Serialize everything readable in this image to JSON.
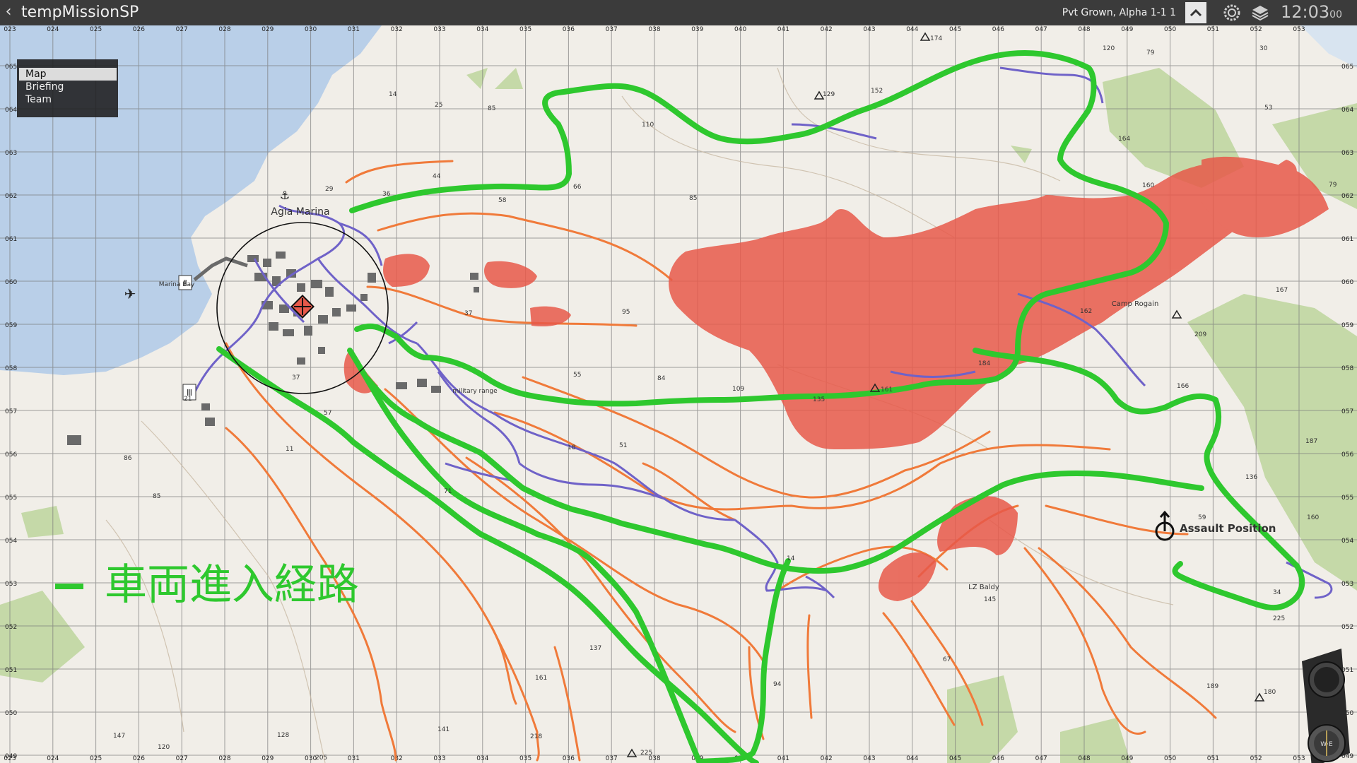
{
  "window": {
    "title": "tempMissionSP",
    "player": "Pvt Grown, Alpha 1-1 1",
    "time": "12:03",
    "time_seconds": "00"
  },
  "icons": {
    "back": "chevron-left-icon",
    "toggle": "chevron-up-icon",
    "settings": "gear-icon",
    "layers": "layers-icon",
    "compass": "compass-icon"
  },
  "menu": {
    "items": [
      {
        "label": "Map",
        "active": true
      },
      {
        "label": "Briefing",
        "active": false
      },
      {
        "label": "Team",
        "active": false
      }
    ]
  },
  "grid": {
    "x_labels": [
      "023",
      "024",
      "025",
      "026",
      "027",
      "028",
      "029",
      "030",
      "031",
      "032",
      "033",
      "034",
      "035",
      "036",
      "037",
      "038",
      "039",
      "040",
      "041",
      "042",
      "043",
      "044",
      "045",
      "046",
      "047",
      "048",
      "049",
      "050",
      "051",
      "052",
      "053"
    ],
    "y_labels": [
      "065",
      "064",
      "063",
      "062",
      "061",
      "060",
      "059",
      "058",
      "057",
      "056",
      "055",
      "054",
      "053",
      "052",
      "051",
      "050",
      "049"
    ]
  },
  "map_labels": {
    "town": "Agia Marina",
    "bay": "Marina Bay",
    "range": "military range",
    "camp": "Camp Rogain",
    "lz": "LZ Baldy",
    "assault": "Assault Position"
  },
  "elevations": [
    "174",
    "79",
    "30",
    "120",
    "152",
    "129",
    "53",
    "14",
    "25",
    "85",
    "110",
    "164",
    "160",
    "79",
    "44",
    "58",
    "66",
    "85",
    "36",
    "29",
    "95",
    "37",
    "167",
    "162",
    "209",
    "55",
    "84",
    "109",
    "184",
    "135",
    "161",
    "166",
    "187",
    "37",
    "57",
    "21",
    "11",
    "86",
    "85",
    "71",
    "18",
    "51",
    "59",
    "136",
    "14",
    "145",
    "67",
    "137",
    "161",
    "94",
    "189",
    "225",
    "180",
    "141",
    "128",
    "120",
    "147",
    "205",
    "218",
    "225",
    "34",
    "160"
  ],
  "legend": {
    "label": "車両進入経路"
  },
  "colors": {
    "route": "#2ec82e",
    "road": "#6f62c8",
    "enemy_zone": "#e8594a",
    "phase_line": "#f07a3a",
    "sea": "#b9cfe8",
    "land": "#f1eee8",
    "forest": "#c5d9a8"
  }
}
